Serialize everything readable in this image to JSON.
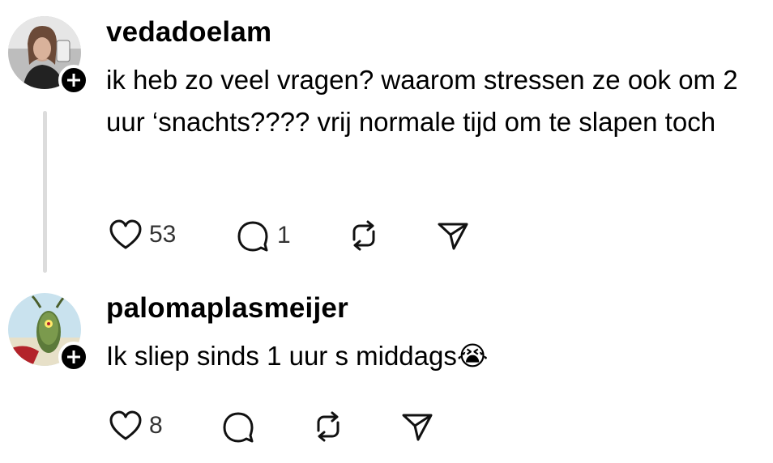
{
  "comments": [
    {
      "username": "vedadoelam",
      "text": "ik heb zo veel vragen? waarom stressen ze ook om 2 uur ‘snachts???? vrij normale tijd om te slapen toch",
      "likes": "53",
      "replies": "1",
      "icons": [
        "heart-icon",
        "comment-icon",
        "repost-icon",
        "share-icon"
      ]
    },
    {
      "username": "palomaplasmeijer",
      "text": "Ik sliep sinds 1 uur s middags😭",
      "likes": "8",
      "icons": [
        "heart-icon",
        "comment-icon",
        "repost-icon",
        "share-icon"
      ]
    }
  ]
}
